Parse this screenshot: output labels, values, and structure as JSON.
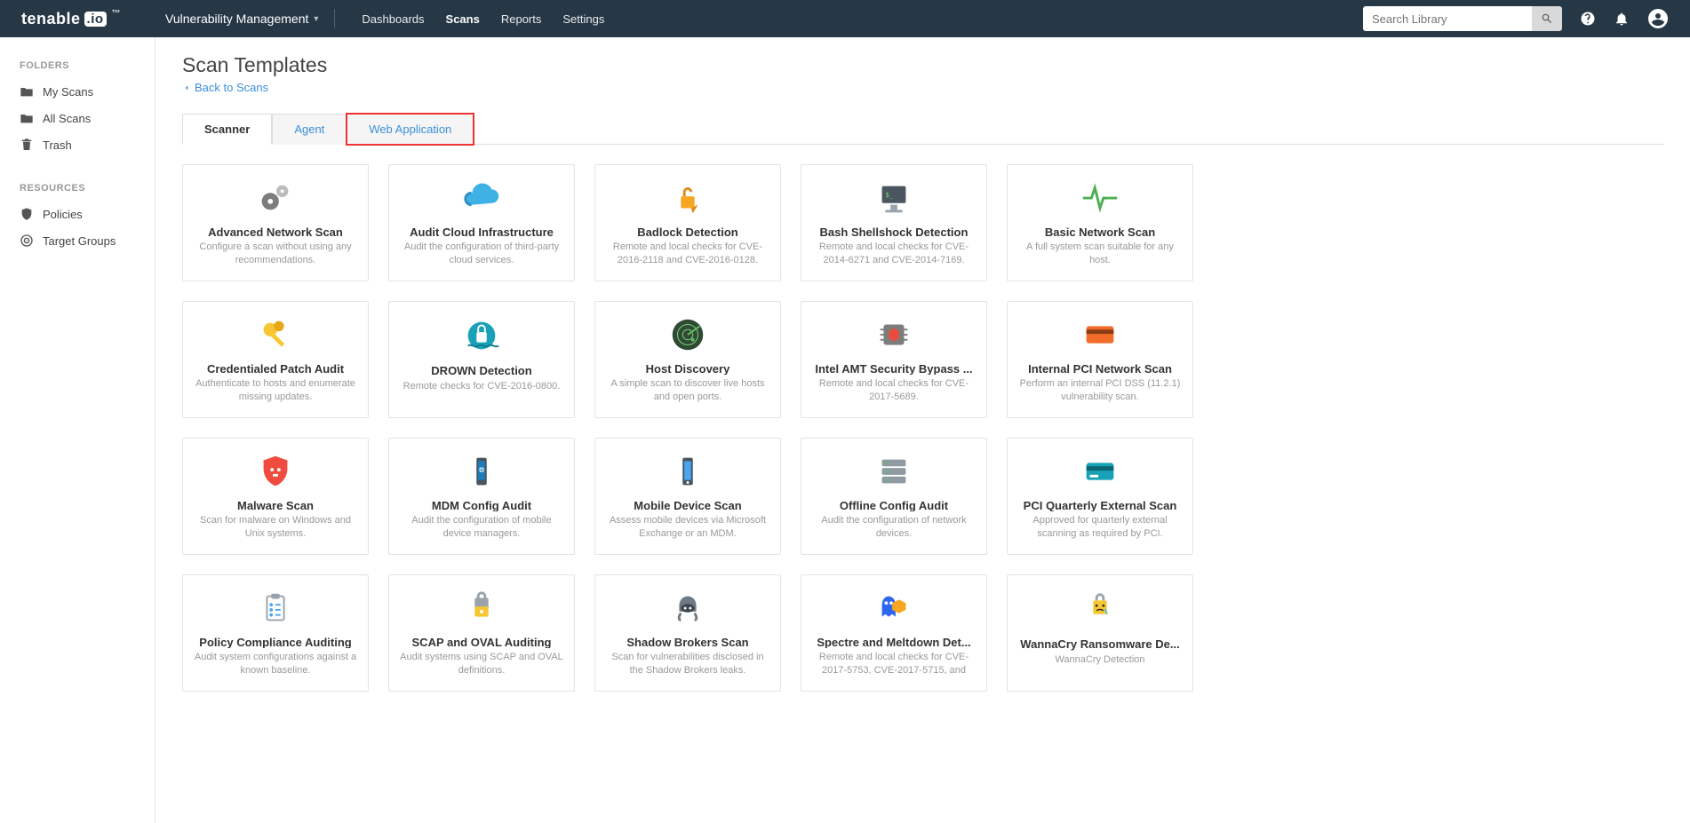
{
  "brand": {
    "name_a": "tenable",
    "name_b": ".io"
  },
  "product": "Vulnerability Management",
  "nav": [
    "Dashboards",
    "Scans",
    "Reports",
    "Settings"
  ],
  "nav_active": 1,
  "search_placeholder": "Search Library",
  "sidebar": {
    "folders_label": "FOLDERS",
    "folders": [
      "My Scans",
      "All Scans",
      "Trash"
    ],
    "resources_label": "RESOURCES",
    "resources": [
      "Policies",
      "Target Groups"
    ]
  },
  "page": {
    "title": "Scan Templates",
    "back": "Back to Scans"
  },
  "tabs": [
    "Scanner",
    "Agent",
    "Web Application"
  ],
  "tabs_active": 0,
  "tabs_highlight": 2,
  "templates": [
    {
      "title": "Advanced Network Scan",
      "desc": "Configure a scan without using any recommendations.",
      "icon": "gears",
      "c1": "#7d7d7d",
      "c2": "#bcbcbc"
    },
    {
      "title": "Audit Cloud Infrastructure",
      "desc": "Audit the configuration of third-party cloud services.",
      "icon": "cloud",
      "c1": "#3fb1e5",
      "c2": "#2f8ec0"
    },
    {
      "title": "Badlock Detection",
      "desc": "Remote and local checks for CVE-2016-2118 and CVE-2016-0128.",
      "icon": "badlock",
      "c1": "#f6a623",
      "c2": "#e0891b"
    },
    {
      "title": "Bash Shellshock Detection",
      "desc": "Remote and local checks for CVE-2014-6271 and CVE-2014-7169.",
      "icon": "terminal",
      "c1": "#4a555f",
      "c2": "#9aa3ab"
    },
    {
      "title": "Basic Network Scan",
      "desc": "A full system scan suitable for any host.",
      "icon": "pulse",
      "c1": "#4caf50",
      "c2": "#4caf50"
    },
    {
      "title": "Credentialed Patch Audit",
      "desc": "Authenticate to hosts and enumerate missing updates.",
      "icon": "keys",
      "c1": "#f6c733",
      "c2": "#e6a817"
    },
    {
      "title": "DROWN Detection",
      "desc": "Remote checks for CVE-2016-0800.",
      "icon": "drown",
      "c1": "#18a1b7",
      "c2": "#0e7c8f"
    },
    {
      "title": "Host Discovery",
      "desc": "A simple scan to discover live hosts and open ports.",
      "icon": "radar",
      "c1": "#2f4a33",
      "c2": "#5fbf63"
    },
    {
      "title": "Intel AMT Security Bypass ...",
      "desc": "Remote and local checks for CVE-2017-5689.",
      "icon": "chip",
      "c1": "#e94b3c",
      "c2": "#7d7d7d"
    },
    {
      "title": "Internal PCI Network Scan",
      "desc": "Perform an internal PCI DSS (11.2.1) vulnerability scan.",
      "icon": "card",
      "c1": "#f26c2a",
      "c2": "#8b3c15"
    },
    {
      "title": "Malware Scan",
      "desc": "Scan for malware on Windows and Unix systems.",
      "icon": "shield-skull",
      "c1": "#ef4b3e",
      "c2": "#bd2b1f"
    },
    {
      "title": "MDM Config Audit",
      "desc": "Audit the configuration of mobile device managers.",
      "icon": "mdm",
      "c1": "#1b7fbf",
      "c2": "#4a555f"
    },
    {
      "title": "Mobile Device Scan",
      "desc": "Assess mobile devices via Microsoft Exchange or an MDM.",
      "icon": "mobile",
      "c1": "#4aa6f0",
      "c2": "#4a555f"
    },
    {
      "title": "Offline Config Audit",
      "desc": "Audit the configuration of network devices.",
      "icon": "stack",
      "c1": "#8f9aa3",
      "c2": "#5f6a73"
    },
    {
      "title": "PCI Quarterly External Scan",
      "desc": "Approved for quarterly external scanning as required by PCI.",
      "icon": "card2",
      "c1": "#18a1b7",
      "c2": "#0c6472"
    },
    {
      "title": "Policy Compliance Auditing",
      "desc": "Audit system configurations against a known baseline.",
      "icon": "clipboard",
      "c1": "#4aa6f0",
      "c2": "#9aa3ab"
    },
    {
      "title": "SCAP and OVAL Auditing",
      "desc": "Audit systems using SCAP and OVAL definitions.",
      "icon": "scap",
      "c1": "#f6c733",
      "c2": "#9aa3ab"
    },
    {
      "title": "Shadow Brokers Scan",
      "desc": "Scan for vulnerabilities disclosed in the Shadow Brokers leaks.",
      "icon": "hacker",
      "c1": "#6f7a84",
      "c2": "#3d454d"
    },
    {
      "title": "Spectre and Meltdown Det...",
      "desc": "Remote and local checks for CVE-2017-5753, CVE-2017-5715, and",
      "icon": "spectre",
      "c1": "#2d67f0",
      "c2": "#f6a623"
    },
    {
      "title": "WannaCry Ransomware De...",
      "desc": "WannaCry Detection",
      "icon": "wannacry",
      "c1": "#f6c733",
      "c2": "#9aa3ab"
    }
  ]
}
